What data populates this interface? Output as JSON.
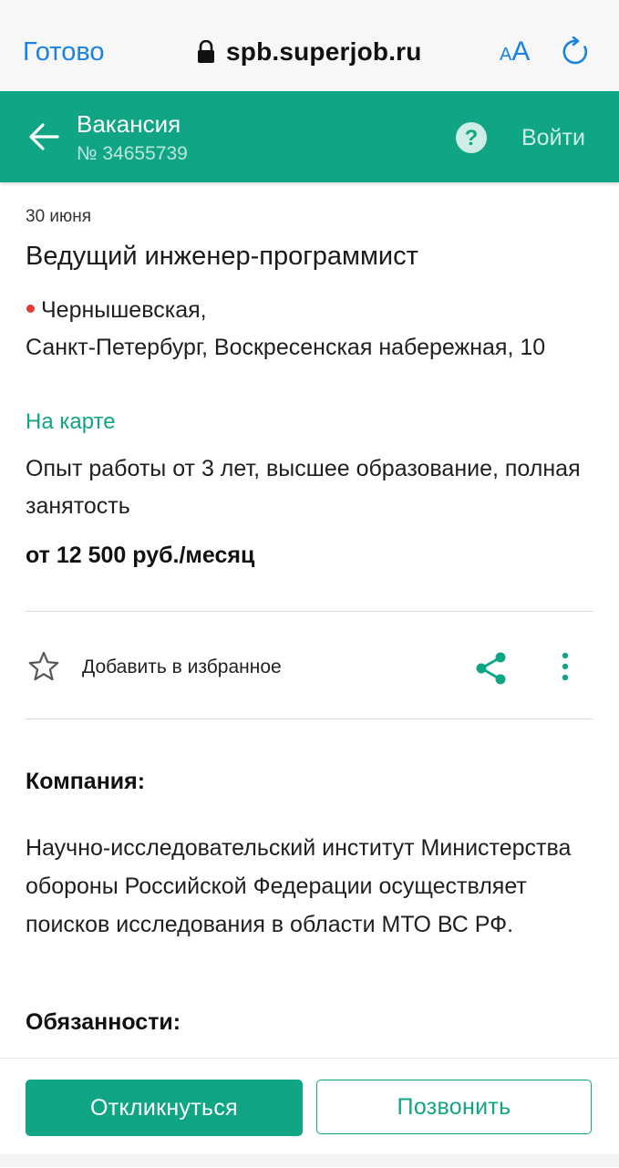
{
  "browser": {
    "done_label": "Готово",
    "url": "spb.superjob.ru",
    "text_size_small": "A",
    "text_size_big": "A",
    "accent_color": "#1a82e2"
  },
  "header": {
    "title": "Вакансия",
    "subtitle": "№ 34655739",
    "login_label": "Войти",
    "background_color": "#0fa585"
  },
  "vacancy": {
    "date": "30 июня",
    "title": "Ведущий инженер-программист",
    "metro": "Чернышевская,",
    "address": "Санкт-Петербург, Воскресенская набережная, 10",
    "map_link": "На карте",
    "requirements": "Опыт работы от 3 лет, высшее образование, полная занятость",
    "salary": "от 12 500 руб./месяц"
  },
  "actions": {
    "favorite_label": "Добавить в избранное",
    "icons": [
      "star-icon",
      "share-icon",
      "more-vertical-icon"
    ]
  },
  "company": {
    "heading": "Компания:",
    "description": "Научно-исследовательский институт Министерства обороны Российской Федерации осуществляет поисков исследования в области МТО ВС РФ."
  },
  "duties": {
    "heading": "Обязанности:"
  },
  "bottom_bar": {
    "respond_label": "Откликнуться",
    "call_label": "Позвонить"
  }
}
